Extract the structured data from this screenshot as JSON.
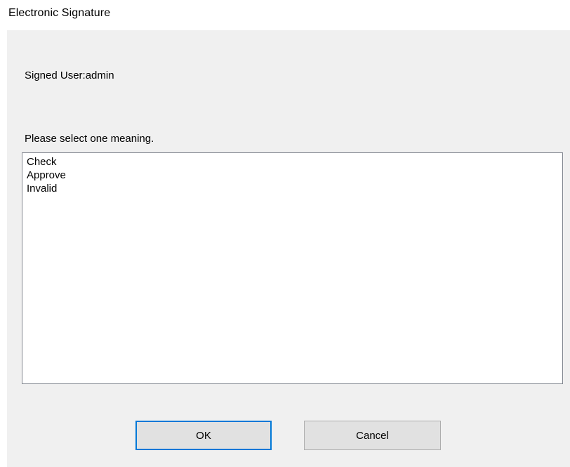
{
  "window": {
    "title": "Electronic Signature"
  },
  "dialog": {
    "signed_user": "Signed User:admin",
    "prompt": "Please select one meaning.",
    "meanings": [
      "Check",
      "Approve",
      "Invalid"
    ],
    "ok_label": "OK",
    "cancel_label": "Cancel"
  },
  "colors": {
    "dialog_background": "#f0f0f0",
    "listbox_border": "#828790",
    "button_background": "#e1e1e1",
    "default_button_focus": "#0078d7"
  }
}
